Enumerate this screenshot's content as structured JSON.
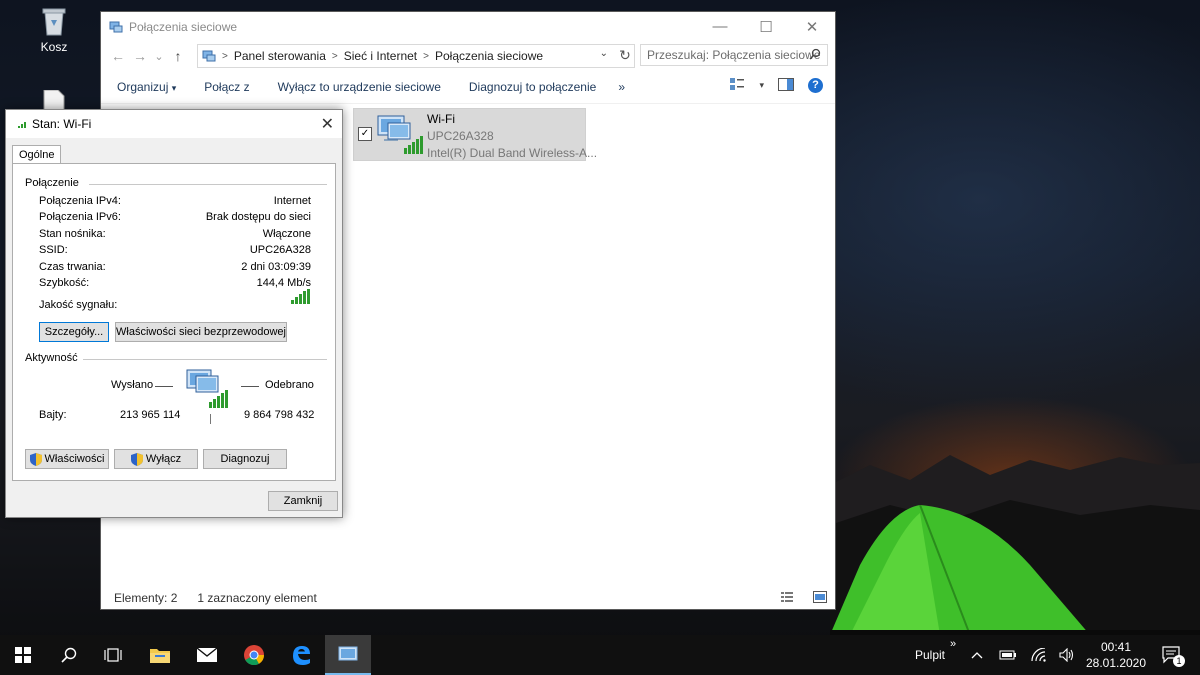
{
  "desktop": {
    "icons": [
      {
        "label": "Kosz",
        "icon": "recycle-bin-icon"
      },
      {
        "label": "",
        "icon": "file-icon"
      }
    ]
  },
  "explorer": {
    "title": "Połączenia sieciowe",
    "window_controls": {
      "minimize": "—",
      "maximize": "☐",
      "close": "✕"
    },
    "nav": {
      "back": "←",
      "forward": "→",
      "recent": "⌄",
      "up": "↑"
    },
    "breadcrumbs": [
      "Panel sterowania",
      "Sieć i Internet",
      "Połączenia sieciowe"
    ],
    "search_placeholder": "Przeszukaj: Połączenia sieciowe",
    "toolbar": {
      "organize": "Organizuj",
      "organize_arrow": "▾",
      "connect": "Połącz z",
      "disable": "Wyłącz to urządzenie sieciowe",
      "diagnose": "Diagnozuj to połączenie",
      "more": "»",
      "view_arrow": "▾",
      "help": "?"
    },
    "item": {
      "name": "Wi-Fi",
      "ssid": "UPC26A328",
      "adapter": "Intel(R) Dual Band Wireless-A...",
      "checked": "✓"
    },
    "status": {
      "count": "Elementy: 2",
      "selected": "1 zaznaczony element"
    }
  },
  "dialog": {
    "title": "Stan: Wi-Fi",
    "close": "✕",
    "tab": "Ogólne",
    "connection_group": "Połączenie",
    "rows": [
      {
        "label": "Połączenia IPv4:",
        "value": "Internet"
      },
      {
        "label": "Połączenia IPv6:",
        "value": "Brak dostępu do sieci"
      },
      {
        "label": "Stan nośnika:",
        "value": "Włączone"
      },
      {
        "label": "SSID:",
        "value": "UPC26A328"
      },
      {
        "label": "Czas trwania:",
        "value": "2 dni 03:09:39"
      },
      {
        "label": "Szybkość:",
        "value": "144,4 Mb/s"
      }
    ],
    "signal_label": "Jakość sygnału:",
    "signal_level": 5,
    "details_btn": "Szczegóły...",
    "wireless_props_btn": "Właściwości sieci bezprzewodowej",
    "activity_group": "Aktywność",
    "sent_label": "Wysłano",
    "received_label": "Odebrano",
    "bytes_label": "Bajty:",
    "bytes_sent": "213 965 114",
    "bytes_received": "9 864 798 432",
    "properties_btn": "Właściwości",
    "disable_btn": "Wyłącz",
    "diagnose_btn": "Diagnozuj",
    "close_btn": "Zamknij"
  },
  "taskbar": {
    "desktop_label": "Pulpit",
    "overflow": "»",
    "time": "00:41",
    "date": "28.01.2020",
    "notification_count": "1"
  },
  "colors": {
    "link": "#1e395b",
    "accent": "#0078d7",
    "signal": "#2e9b2e",
    "help": "#1e6fd0"
  }
}
